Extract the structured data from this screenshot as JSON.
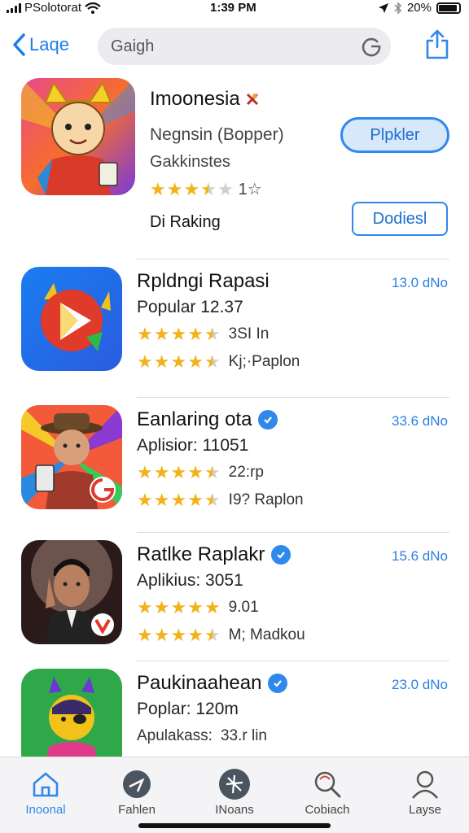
{
  "status": {
    "carrier": "PSolotorat",
    "time": "1:39 PM",
    "battery": "20%"
  },
  "nav": {
    "back_label": "Laqe",
    "search_placeholder": "Gaigh"
  },
  "featured": {
    "title": "Imoonesia",
    "subtitle": "Negnsin (Bopper)",
    "category": "Gakkinstes",
    "rating": 3.5,
    "rating_count": "1☆",
    "ranking": "Di Raking",
    "primary_button": "Plpkler",
    "secondary_button": "Dodiesl"
  },
  "apps": [
    {
      "name": "Rpldngi Rapasi",
      "line2": "Popular 12.37",
      "rating1": 4.5,
      "rating1_text": "3SI In",
      "rating2": 4.5,
      "rating2_text": "Kj;·Paplon",
      "size": "13.0 dNo",
      "verified": false
    },
    {
      "name": "Eanlaring ota",
      "line2": "Aplisior: 11051",
      "rating1": 4.5,
      "rating1_text": "22:rp",
      "rating2": 4.5,
      "rating2_text": "I9? Raplon",
      "size": "33.6 dNo",
      "verified": true
    },
    {
      "name": "Ratlke Raplakr",
      "line2": "Aplikius: 3051",
      "rating1": 5,
      "rating1_text": "9.01",
      "rating2": 4.5,
      "rating2_text": "M; Madkou",
      "size": "15.6 dNo",
      "verified": true
    },
    {
      "name": "Paukinaahean",
      "line2": "Poplar: 120m",
      "rating1_text": "33.r lin",
      "line3": "Apulakass:",
      "size": "23.0 dNo",
      "verified": true
    }
  ],
  "tabs": [
    {
      "label": "Inoonal",
      "icon": "home-icon",
      "active": true
    },
    {
      "label": "Fahlen",
      "icon": "explore-icon",
      "active": false
    },
    {
      "label": "INoans",
      "icon": "star-burst-icon",
      "active": false
    },
    {
      "label": "Cobiach",
      "icon": "search-icon",
      "active": false
    },
    {
      "label": "Layse",
      "icon": "person-icon",
      "active": false
    }
  ],
  "colors": {
    "accent": "#2f88ec",
    "star": "#f3b21a"
  }
}
